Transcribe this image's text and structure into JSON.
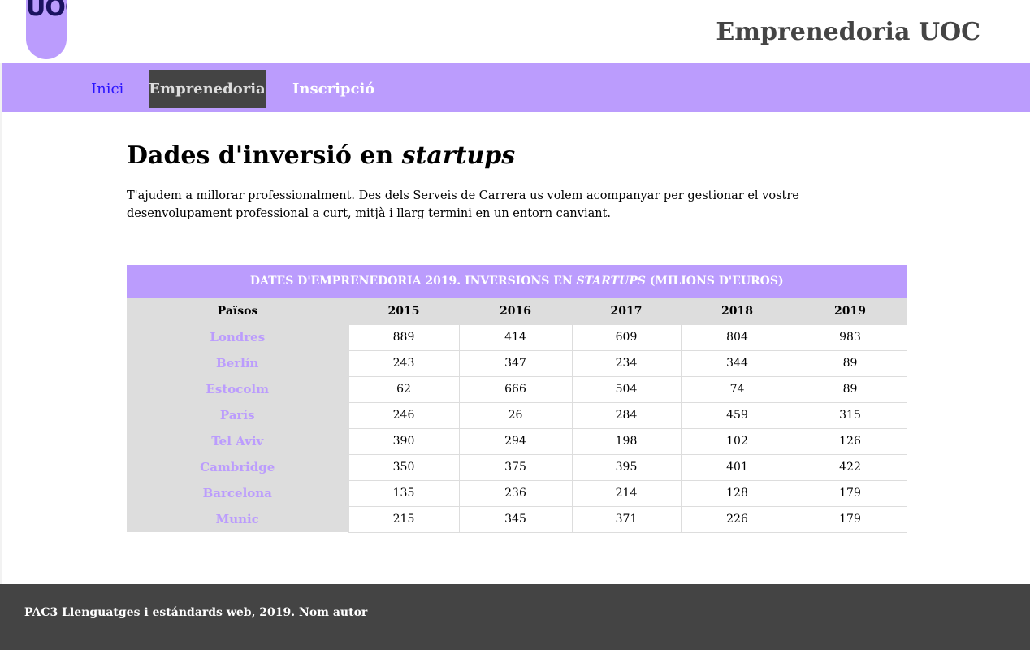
{
  "header": {
    "logo_text": "UOC",
    "site_title": "Emprenedoria UOC"
  },
  "nav": {
    "items": [
      {
        "label": "Inici"
      },
      {
        "label": "Emprenedoria"
      },
      {
        "label": "Inscripció"
      }
    ]
  },
  "main": {
    "title_prefix": "Dades d'inversió en ",
    "title_em": "startups",
    "intro": "T'ajudem a millorar professionalment. Des dels Serveis de Carrera us volem acompanyar per gestionar el vostre desenvolupament professional a curt, mitjà i llarg termini en un entorn canviant."
  },
  "table": {
    "caption_prefix": "Dates d'emprenedoria 2019. Inversions en ",
    "caption_em": "startups",
    "caption_suffix": " (milions d'euros)",
    "headers": [
      "Països",
      "2015",
      "2016",
      "2017",
      "2018",
      "2019"
    ],
    "rows": [
      {
        "city": "Londres",
        "values": [
          "889",
          "414",
          "609",
          "804",
          "983"
        ]
      },
      {
        "city": "Berlín",
        "values": [
          "243",
          "347",
          "234",
          "344",
          "89"
        ]
      },
      {
        "city": "Estocolm",
        "values": [
          "62",
          "666",
          "504",
          "74",
          "89"
        ]
      },
      {
        "city": "París",
        "values": [
          "246",
          "26",
          "284",
          "459",
          "315"
        ]
      },
      {
        "city": "Tel Aviv",
        "values": [
          "390",
          "294",
          "198",
          "102",
          "126"
        ]
      },
      {
        "city": "Cambridge",
        "values": [
          "350",
          "375",
          "395",
          "401",
          "422"
        ]
      },
      {
        "city": "Barcelona",
        "values": [
          "135",
          "236",
          "214",
          "128",
          "179"
        ]
      },
      {
        "city": "Munic",
        "values": [
          "215",
          "345",
          "371",
          "226",
          "179"
        ]
      }
    ]
  },
  "footer": {
    "text": "PAC3 Llenguatges i estándards web, 2019. ",
    "author": "Nom autor"
  },
  "colors": {
    "accent": "#bb9cfd",
    "dark": "#444444",
    "link": "#2a14ff",
    "table_header_bg": "#dddddd"
  }
}
